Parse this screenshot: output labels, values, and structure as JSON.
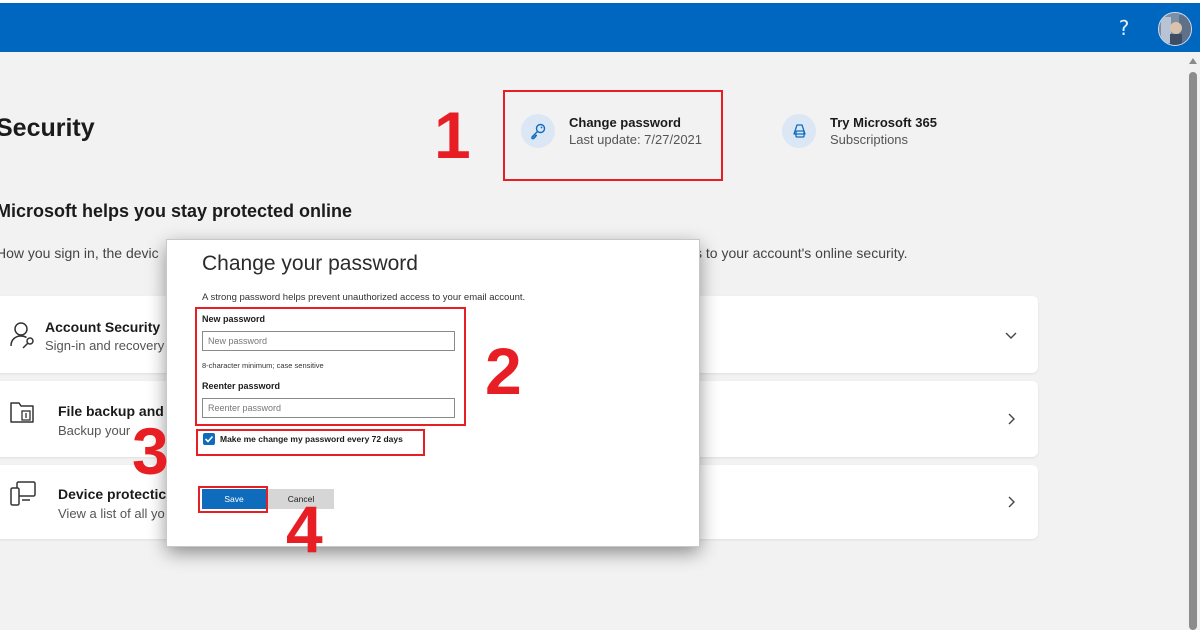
{
  "header": {
    "help_glyph": "?",
    "brand_color": "#0067c0"
  },
  "page": {
    "title": "Security"
  },
  "quick_links": [
    {
      "title": "Change password",
      "subtitle": "Last update: 7/27/2021",
      "icon": "key-icon"
    },
    {
      "title": "Try Microsoft 365",
      "subtitle": "Subscriptions",
      "icon": "microsoft365-icon"
    }
  ],
  "section": {
    "heading": "Microsoft helps you stay protected online",
    "description_left": "How you sign in, the devic",
    "description_right": "s to your account's online security."
  },
  "cards": [
    {
      "title": "Account Security",
      "subtitle": "Sign-in and recovery",
      "icon": "account-key-icon",
      "chevron": "down"
    },
    {
      "title": "File backup and",
      "subtitle": "Backup your",
      "icon": "folder-backup-icon",
      "chevron": "right"
    },
    {
      "title": "Device protectic",
      "subtitle": "View a list of all yo",
      "icon": "device-icon",
      "chevron": "right"
    }
  ],
  "dialog": {
    "title": "Change your password",
    "description": "A strong password helps prevent unauthorized access to your email account.",
    "new_password_label": "New password",
    "new_password_placeholder": "New password",
    "hint": "8-character minimum; case sensitive",
    "reenter_label": "Reenter password",
    "reenter_placeholder": "Reenter password",
    "checkbox_label": "Make me change my password every 72 days",
    "checkbox_checked": true,
    "save_label": "Save",
    "cancel_label": "Cancel"
  },
  "annotations": {
    "color": "#e81e25",
    "numbers": [
      "1",
      "2",
      "3",
      "4"
    ]
  }
}
